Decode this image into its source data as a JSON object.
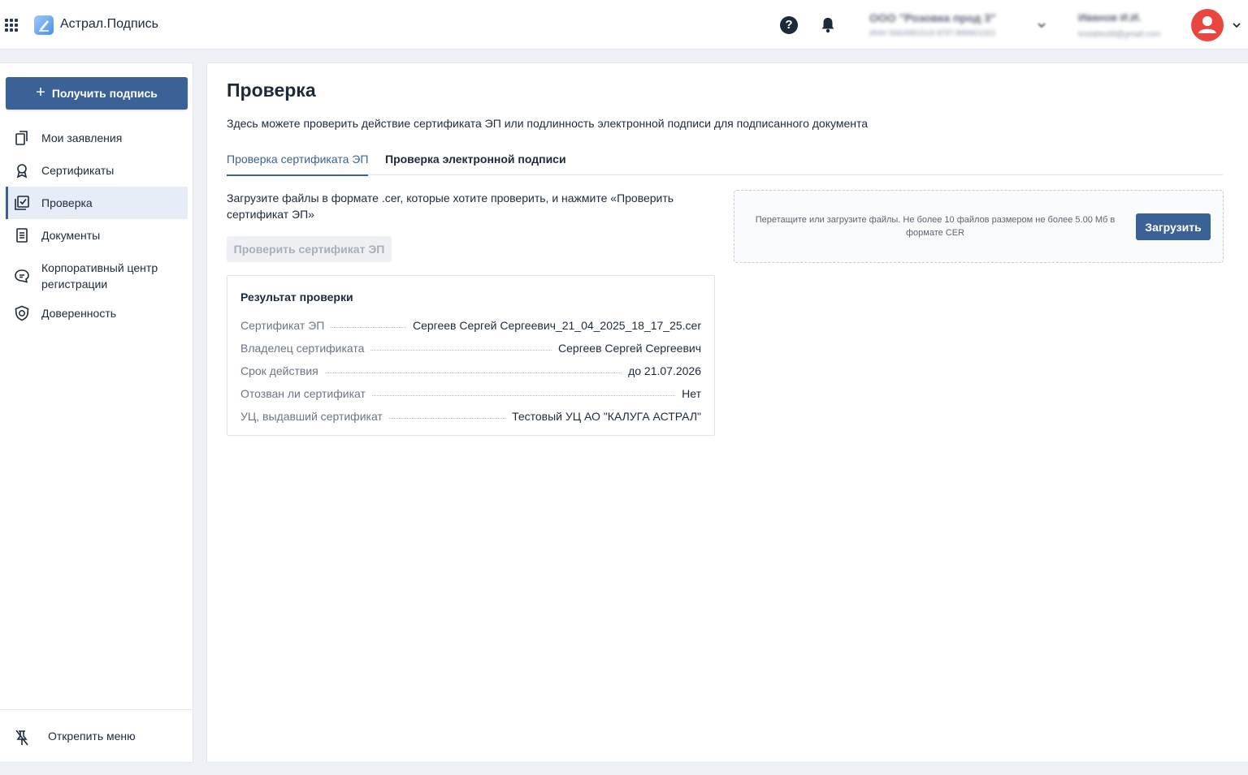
{
  "header": {
    "app_title": "Астрал.Подпись",
    "org_name": "ООО \"Розовка прод 3\"",
    "org_ids": "ИНН 5664981519  КПП 999901001",
    "user_name": "Иванов И.И.",
    "user_email": "testattest8@gmail.com"
  },
  "sidebar": {
    "get_sign_label": "Получить подпись",
    "items": [
      {
        "label": "Мои заявления",
        "icon": "applications-icon"
      },
      {
        "label": "Сертификаты",
        "icon": "certificate-icon"
      },
      {
        "label": "Проверка",
        "icon": "check-icon"
      },
      {
        "label": "Документы",
        "icon": "document-icon"
      },
      {
        "label": "Корпоративный центр регистрации",
        "icon": "chat-icon"
      },
      {
        "label": "Доверенность",
        "icon": "shield-icon"
      }
    ],
    "active_item": "Проверка",
    "unpin_label": "Открепить меню"
  },
  "main": {
    "title": "Проверка",
    "description": "Здесь можете проверить действие сертификата ЭП или подлинность электронной подписи для подписанного документа",
    "tabs": [
      {
        "label": "Проверка сертификата ЭП",
        "active": true
      },
      {
        "label": "Проверка электронной подписи",
        "active": false
      }
    ],
    "instruction": "Загрузите файлы в формате .cer, которые хотите проверить, и нажмите «Проверить сертификат ЭП»",
    "check_button_label": "Проверить сертификат ЭП",
    "result": {
      "title": "Результат проверки",
      "rows": [
        {
          "key": "Сертификат ЭП",
          "value": "Сергеев Сергей Сергеевич_21_04_2025_18_17_25.cer"
        },
        {
          "key": "Владелец сертификата",
          "value": "Сергеев Сергей Сергеевич"
        },
        {
          "key": "Срок действия",
          "value": "до 21.07.2026"
        },
        {
          "key": "Отозван ли сертификат",
          "value": "Нет"
        },
        {
          "key": "УЦ, выдавший сертификат",
          "value": "Тестовый УЦ АО \"КАЛУГА АСТРАЛ\""
        }
      ]
    },
    "dropzone": {
      "text": "Перетащите или загрузите файлы. Не более 10 файлов размером не более 5.00 Мб в формате CER",
      "upload_label": "Загрузить"
    }
  },
  "colors": {
    "accent": "#3a6296",
    "avatar": "#e8463f",
    "active_bg": "#e6edf6"
  }
}
